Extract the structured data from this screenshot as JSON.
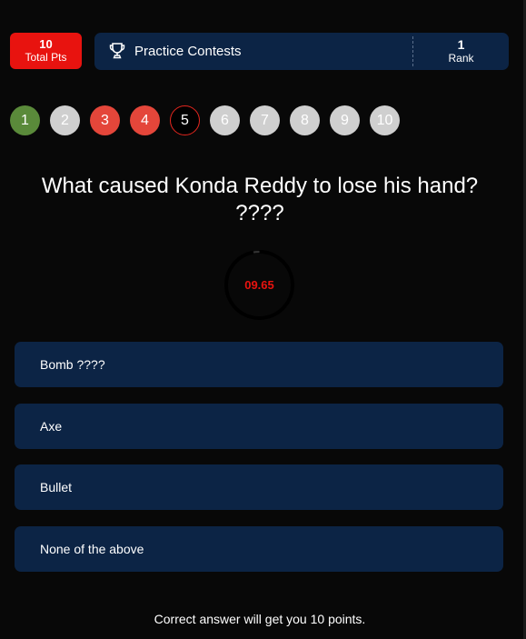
{
  "header": {
    "points_value": "10",
    "points_label": "Total Pts",
    "contest_title": "Practice Contests",
    "rank_value": "1",
    "rank_label": "Rank"
  },
  "question_nav": [
    {
      "number": "1",
      "state": "correct"
    },
    {
      "number": "2",
      "state": "unanswered"
    },
    {
      "number": "3",
      "state": "wrong"
    },
    {
      "number": "4",
      "state": "wrong"
    },
    {
      "number": "5",
      "state": "current"
    },
    {
      "number": "6",
      "state": "unanswered"
    },
    {
      "number": "7",
      "state": "unanswered"
    },
    {
      "number": "8",
      "state": "unanswered"
    },
    {
      "number": "9",
      "state": "unanswered"
    },
    {
      "number": "10",
      "state": "unanswered"
    }
  ],
  "question": {
    "text": "What caused Konda Reddy to lose his hand? ????"
  },
  "timer": {
    "display": "09.65",
    "remaining_fraction": 0.97
  },
  "options": [
    {
      "label": "Bomb ????"
    },
    {
      "label": "Axe"
    },
    {
      "label": "Bullet"
    },
    {
      "label": "None of the above"
    }
  ],
  "footer": {
    "text": "Correct answer will get you 10 points."
  },
  "colors": {
    "background": "#080808",
    "panel": "#0c2445",
    "accent_red": "#e8130f",
    "correct_green": "#5a8a3a",
    "wrong_red": "#e4463a",
    "unanswered_gray": "#cfcfcf"
  },
  "icons": {
    "contest": "trophy-icon"
  }
}
